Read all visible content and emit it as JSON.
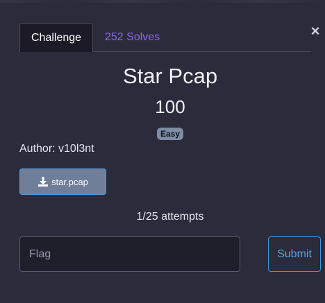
{
  "modal": {
    "close_label": "×"
  },
  "tabs": [
    {
      "label": "Challenge",
      "active": true
    },
    {
      "label": "252 Solves",
      "active": false
    }
  ],
  "challenge": {
    "name": "Star Pcap",
    "points": "100",
    "difficulty": "Easy",
    "author": "Author: v10l3nt",
    "file_name": "star.pcap",
    "attempts": "1/25 attempts"
  },
  "form": {
    "flag_placeholder": "Flag",
    "flag_value": "",
    "submit_label": "Submit"
  },
  "icons": {
    "download": "download-icon",
    "close": "close-icon"
  },
  "colors": {
    "background": "#2c2b3c",
    "solves_link": "#8a6be8",
    "accent_blue": "#4aa8e6",
    "badge": "#7c8da6"
  }
}
